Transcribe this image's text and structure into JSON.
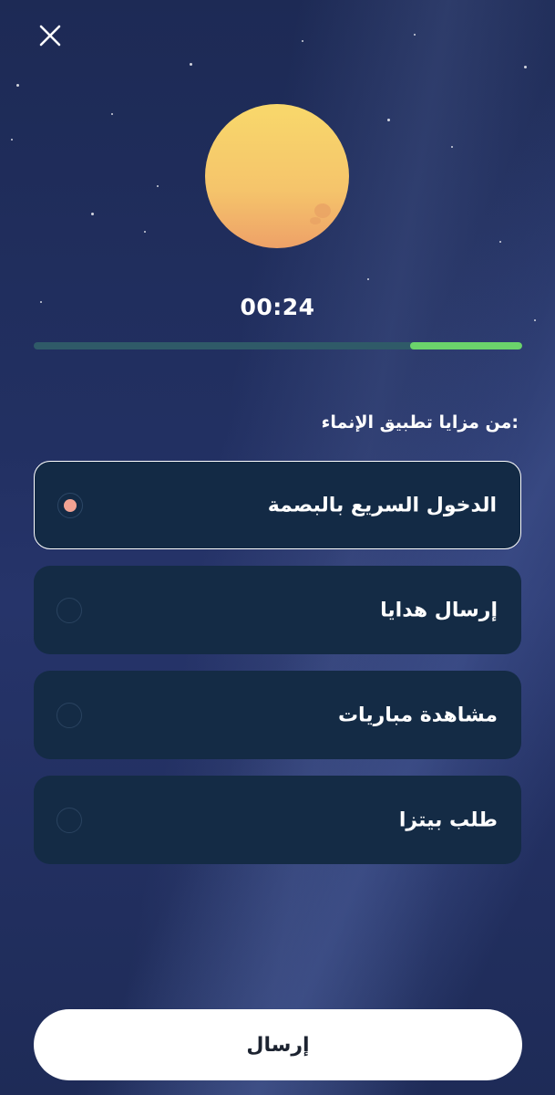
{
  "header": {
    "close_icon": "close-icon"
  },
  "timer": {
    "text": "00:24",
    "progress_fraction": 0.23
  },
  "quiz": {
    "question": ":من مزايا تطبيق الإنماء",
    "options": [
      {
        "label": "الدخول السريع بالبصمة",
        "selected": true
      },
      {
        "label": "إرسال هدايا",
        "selected": false
      },
      {
        "label": "مشاهدة مباريات",
        "selected": false
      },
      {
        "label": "طلب بيتزا",
        "selected": false
      }
    ]
  },
  "submit": {
    "label": "إرسال"
  },
  "colors": {
    "background": "#1f2d57",
    "progress_track": "#2f5a68",
    "progress_fill": "#6bd36b",
    "option_bg": "#142b45",
    "selected_dot": "#f1a293",
    "moon_top": "#f7d36a",
    "moon_bottom": "#eea56a"
  }
}
